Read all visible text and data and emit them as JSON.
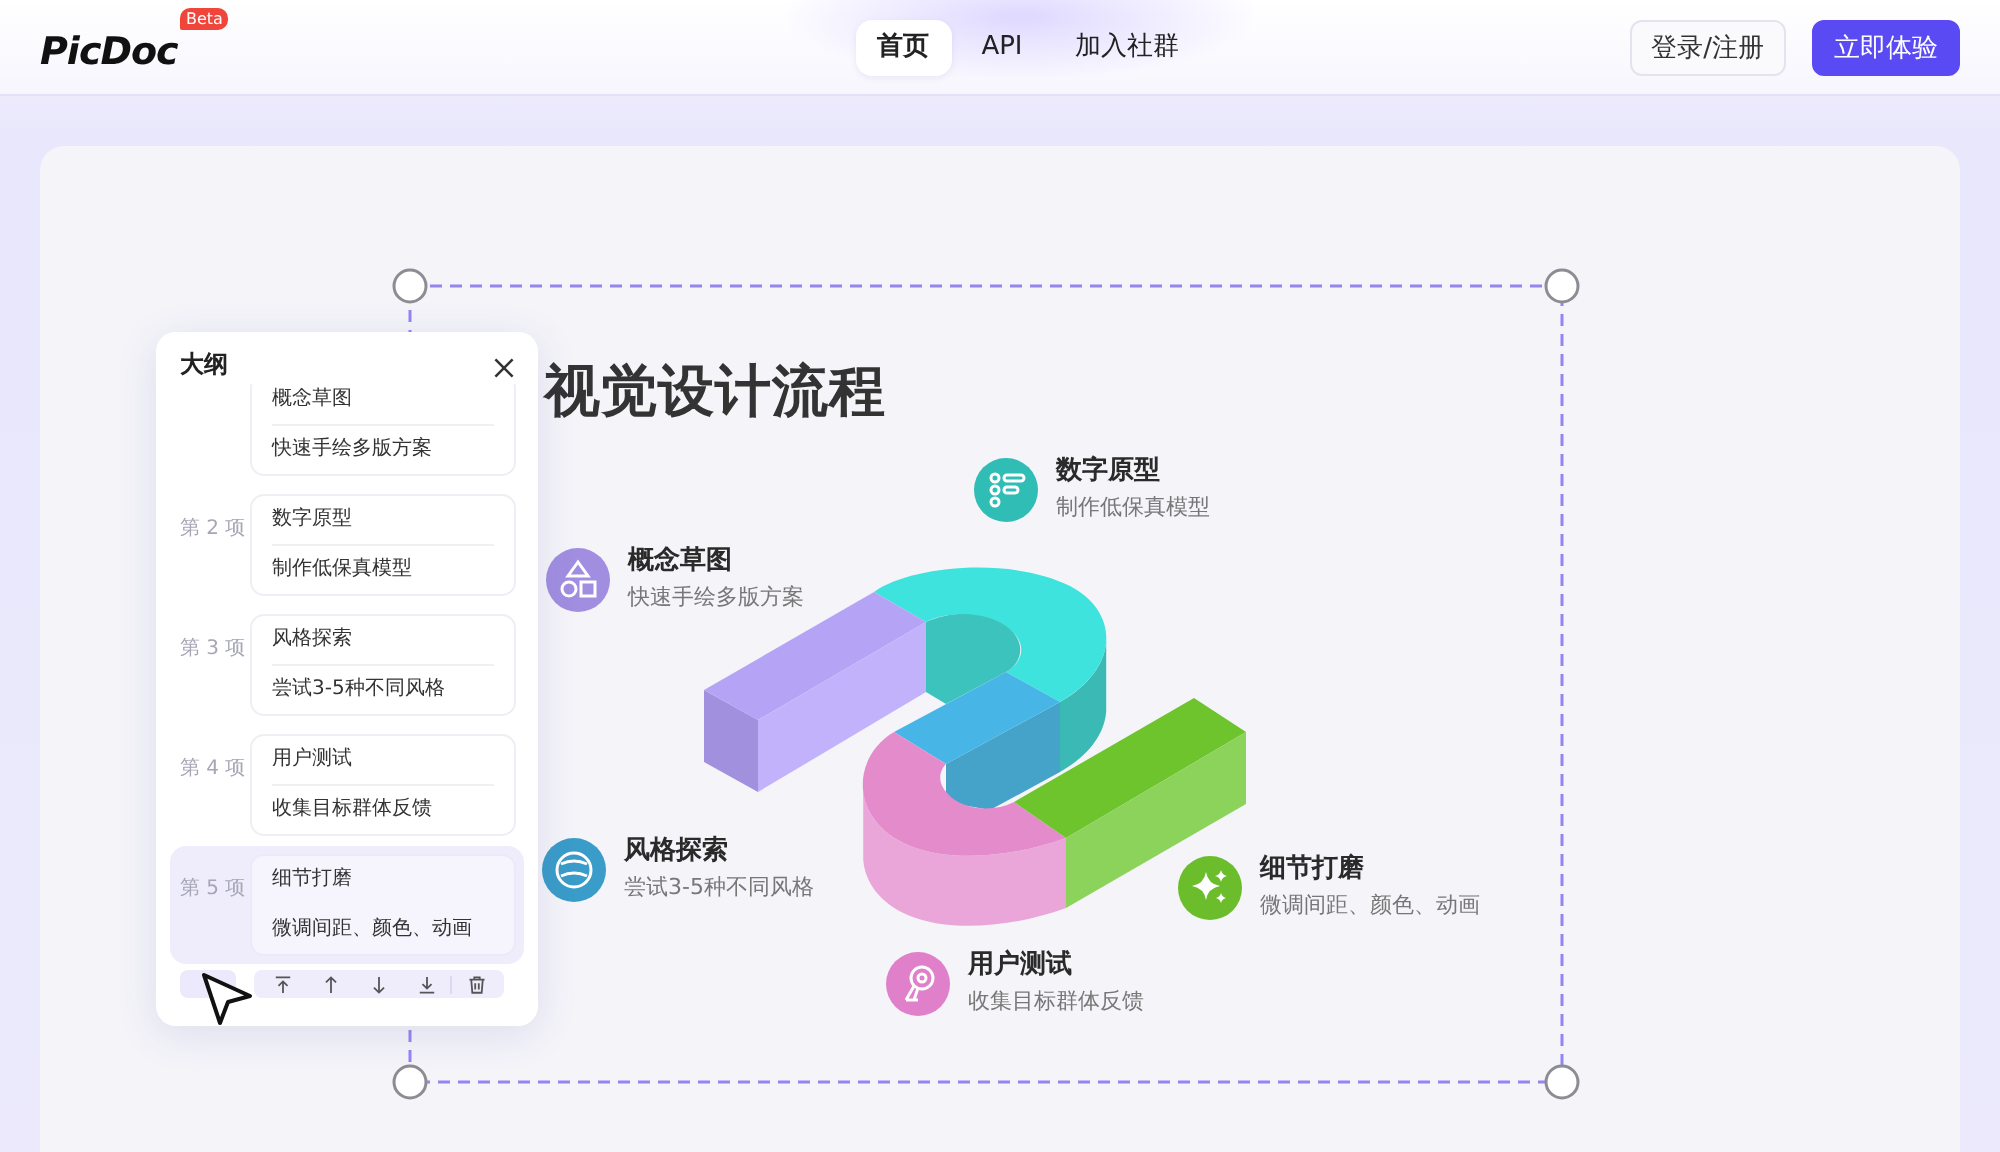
{
  "header": {
    "logo": "PicDoc",
    "badge": "Beta",
    "nav": [
      {
        "label": "首页",
        "selected": true
      },
      {
        "label": "API",
        "selected": false
      },
      {
        "label": "加入社群",
        "selected": false
      }
    ],
    "buttons": [
      {
        "label": "登录/注册",
        "kind": "secondary"
      },
      {
        "label": "立即体验",
        "kind": "primary"
      }
    ]
  },
  "slide": {
    "title": "视觉设计流程",
    "steps": [
      {
        "title": "概念草图",
        "subtitle": "快速手绘多版方案",
        "color": "#a18ee0"
      },
      {
        "title": "数字原型",
        "subtitle": "制作低保真模型",
        "color": "#2fbdb6"
      },
      {
        "title": "风格探索",
        "subtitle": "尝试3-5种不同风格",
        "color": "#3a9cc8"
      },
      {
        "title": "用户测试",
        "subtitle": "收集目标群体反馈",
        "color": "#e07fca"
      },
      {
        "title": "细节打磨",
        "subtitle": "微调间距、颜色、动画",
        "color": "#6bbd2b"
      }
    ]
  },
  "outline": {
    "title": "大纲",
    "items": [
      {
        "title": "概念草图",
        "subtitle": "快速手绘多版方案",
        "selected": false
      },
      {
        "label": "第 2 项",
        "title": "数字原型",
        "subtitle": "制作低保真模型",
        "selected": false
      },
      {
        "label": "第 3 项",
        "title": "风格探索",
        "subtitle": "尝试3-5种不同风格",
        "selected": false
      },
      {
        "label": "第 4 项",
        "title": "用户测试",
        "subtitle": "收集目标群体反馈",
        "selected": false
      },
      {
        "label": "第 5 项",
        "title": "细节打磨",
        "subtitle": "微调间距、颜色、动画",
        "selected": true
      }
    ]
  }
}
